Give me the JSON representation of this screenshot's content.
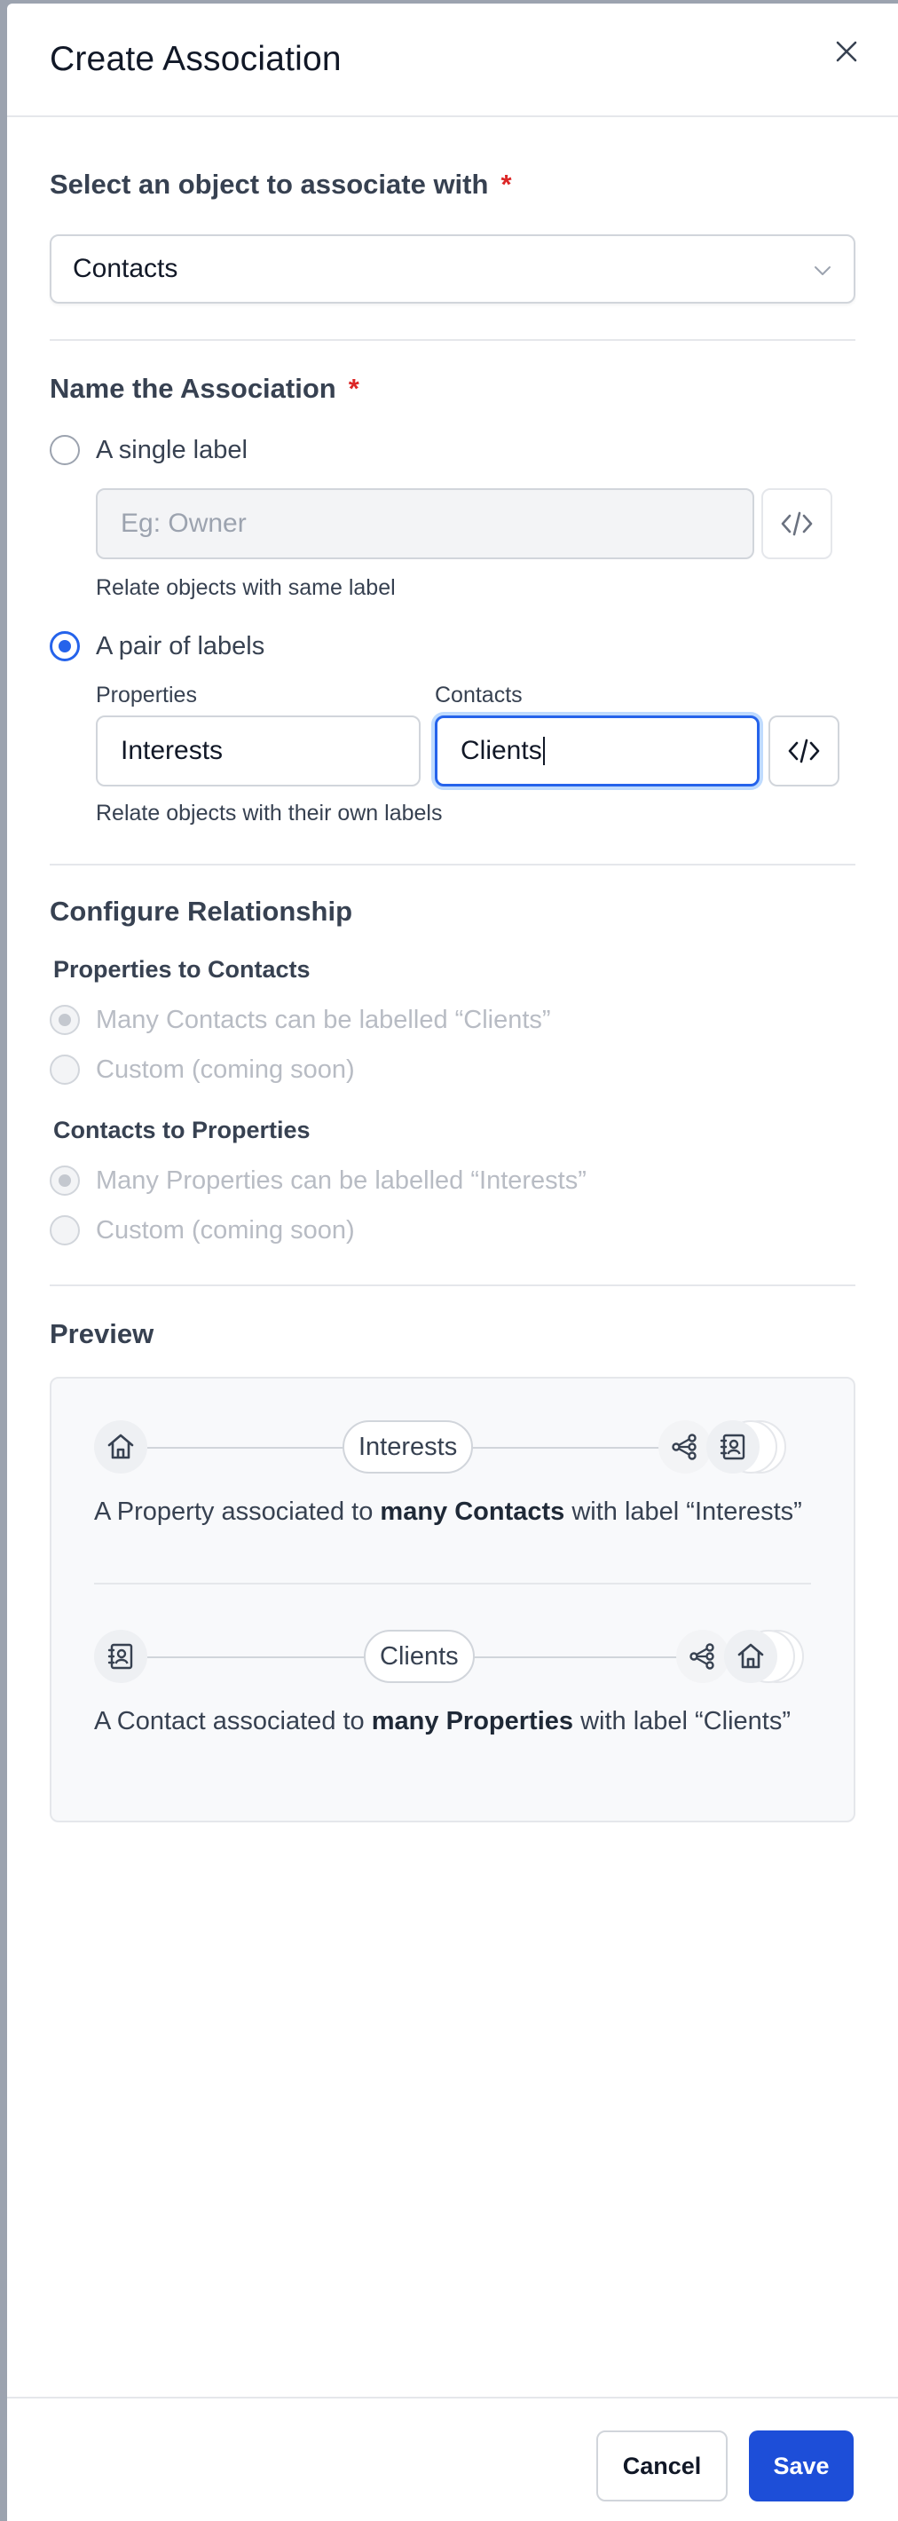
{
  "dialog": {
    "title": "Create Association"
  },
  "object_select": {
    "label": "Select an object to associate with",
    "required_mark": "*",
    "value": "Contacts"
  },
  "naming": {
    "label": "Name the Association",
    "required_mark": "*",
    "single": {
      "label": "A single label",
      "checked": false,
      "placeholder": "Eg: Owner",
      "help": "Relate objects with same label"
    },
    "pair": {
      "label": "A pair of labels",
      "checked": true,
      "left_label": "Properties",
      "left_value": "Interests",
      "right_label": "Contacts",
      "right_value": "Clients",
      "help": "Relate objects with their own labels"
    }
  },
  "relationship": {
    "title": "Configure Relationship",
    "group1": {
      "title": "Properties to Contacts",
      "option1": "Many Contacts can be labelled “Clients”",
      "option2": "Custom (coming soon)"
    },
    "group2": {
      "title": "Contacts to Properties",
      "option1": "Many Properties can be labelled “Interests”",
      "option2": "Custom (coming soon)"
    }
  },
  "preview": {
    "title": "Preview",
    "row1": {
      "pill": "Interests",
      "text_before": "A Property associated to ",
      "text_bold": "many Contacts",
      "text_after": " with label “Interests”"
    },
    "row2": {
      "pill": "Clients",
      "text_before": "A Contact associated to ",
      "text_bold": "many Properties",
      "text_after": " with label “Clients”"
    }
  },
  "footer": {
    "cancel": "Cancel",
    "save": "Save"
  },
  "icons": {
    "close": "close-icon",
    "chevron": "chevron-down-icon",
    "code": "code-brackets-icon",
    "home": "home-icon",
    "contact": "contact-book-icon",
    "relation": "share-nodes-icon"
  },
  "colors": {
    "accent": "#1d4ed8",
    "required": "#dc2626",
    "border": "#d1d5db"
  }
}
